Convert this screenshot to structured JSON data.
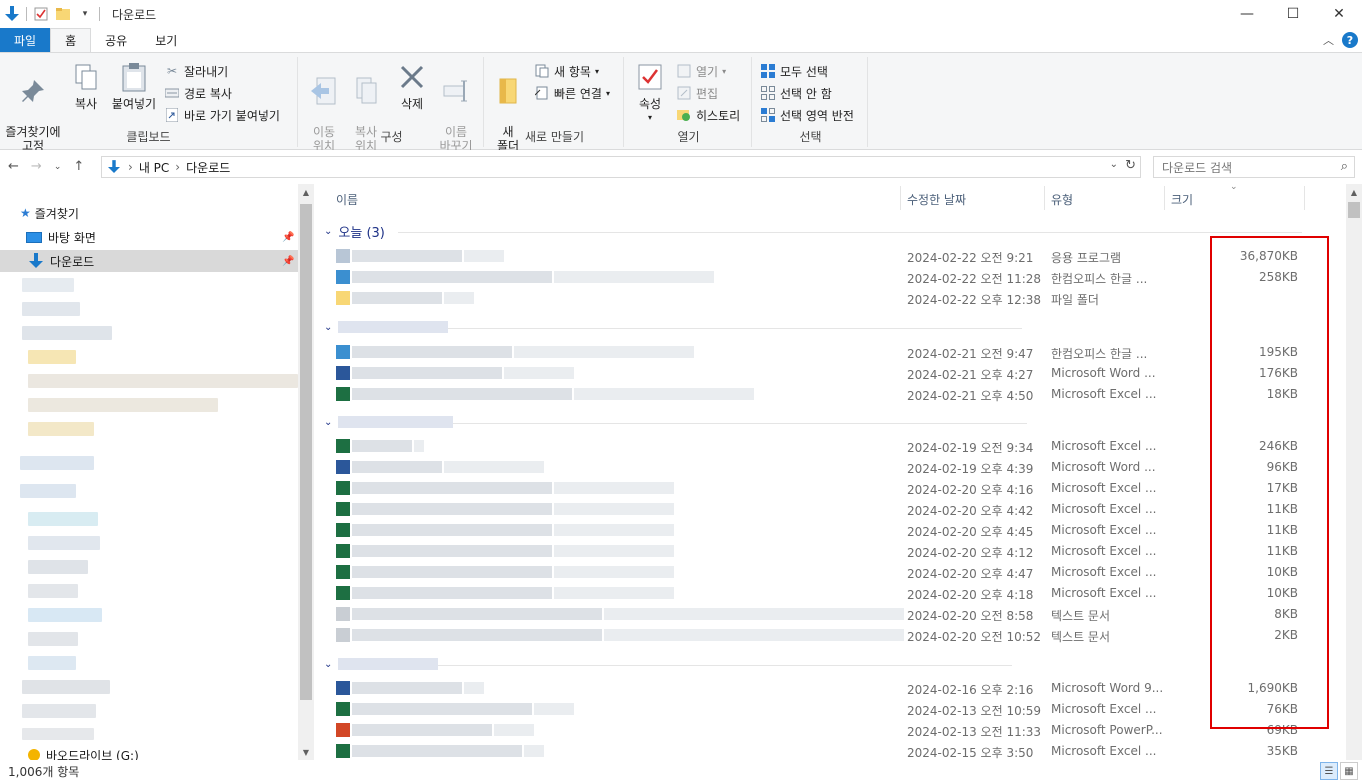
{
  "window": {
    "title": "다운로드",
    "controls": [
      "minimize",
      "maximize",
      "close"
    ]
  },
  "ribbon_tabs": [
    {
      "label": "파일"
    },
    {
      "label": "홈"
    },
    {
      "label": "공유"
    },
    {
      "label": "보기"
    }
  ],
  "ribbon": {
    "clipboard": {
      "pin": "즐겨찾기에\n고정",
      "copy": "복사",
      "paste": "붙여넣기",
      "cut": "잘라내기",
      "copy_path": "경로 복사",
      "paste_shortcut": "바로 가기 붙여넣기",
      "label": "클립보드"
    },
    "organize": {
      "move_to": "이동\n위치",
      "copy_to": "복사\n위치",
      "delete": "삭제",
      "rename": "이름\n바꾸기",
      "label": "구성"
    },
    "new": {
      "new_folder": "새\n폴더",
      "new_item": "새 항목",
      "easy_access": "빠른 연결",
      "label": "새로 만들기"
    },
    "open": {
      "properties": "속성",
      "open": "열기",
      "edit": "편집",
      "history": "히스토리",
      "label": "열기"
    },
    "select": {
      "select_all": "모두 선택",
      "select_none": "선택 안 함",
      "invert": "선택 영역 반전",
      "label": "선택"
    }
  },
  "address": {
    "crumbs": [
      "내 PC",
      "다운로드"
    ],
    "search_placeholder": "다운로드 검색"
  },
  "nav": {
    "quick_access": "즐겨찾기",
    "desktop": "바탕 화면",
    "downloads": "다운로드",
    "bottom_item": "바오드라이브 (G:)"
  },
  "columns": {
    "name": "이름",
    "modified": "수정한 날짜",
    "type": "유형",
    "size": "크기"
  },
  "groups": [
    {
      "label": "오늘 (3)",
      "files": [
        {
          "date": "2024-02-22 오전 9:21",
          "type": "응용 프로그램",
          "size": "36,870KB",
          "icon": "app"
        },
        {
          "date": "2024-02-22 오전 11:28",
          "type": "한컴오피스 한글 ...",
          "size": "258KB",
          "icon": "hwp"
        },
        {
          "date": "2024-02-22 오후 12:38",
          "type": "파일 폴더",
          "size": "",
          "icon": "folder"
        }
      ]
    },
    {
      "label": "",
      "files": [
        {
          "date": "2024-02-21 오전 9:47",
          "type": "한컴오피스 한글 ...",
          "size": "195KB",
          "icon": "hwp"
        },
        {
          "date": "2024-02-21 오후 4:27",
          "type": "Microsoft Word ...",
          "size": "176KB",
          "icon": "word"
        },
        {
          "date": "2024-02-21 오후 4:50",
          "type": "Microsoft Excel ...",
          "size": "18KB",
          "icon": "excel"
        }
      ]
    },
    {
      "label": "",
      "files": [
        {
          "date": "2024-02-19 오전 9:34",
          "type": "Microsoft Excel ...",
          "size": "246KB",
          "icon": "excel"
        },
        {
          "date": "2024-02-19 오후 4:39",
          "type": "Microsoft Word ...",
          "size": "96KB",
          "icon": "word"
        },
        {
          "date": "2024-02-20 오후 4:16",
          "type": "Microsoft Excel ...",
          "size": "17KB",
          "icon": "excel"
        },
        {
          "date": "2024-02-20 오후 4:42",
          "type": "Microsoft Excel ...",
          "size": "11KB",
          "icon": "excel"
        },
        {
          "date": "2024-02-20 오후 4:45",
          "type": "Microsoft Excel ...",
          "size": "11KB",
          "icon": "excel"
        },
        {
          "date": "2024-02-20 오후 4:12",
          "type": "Microsoft Excel ...",
          "size": "11KB",
          "icon": "excel"
        },
        {
          "date": "2024-02-20 오후 4:47",
          "type": "Microsoft Excel ...",
          "size": "10KB",
          "icon": "excel"
        },
        {
          "date": "2024-02-20 오후 4:18",
          "type": "Microsoft Excel ...",
          "size": "10KB",
          "icon": "excel"
        },
        {
          "date": "2024-02-20 오전 8:58",
          "type": "텍스트 문서",
          "size": "8KB",
          "icon": "txt"
        },
        {
          "date": "2024-02-20 오전 10:52",
          "type": "텍스트 문서",
          "size": "2KB",
          "icon": "txt"
        }
      ]
    },
    {
      "label": "",
      "files": [
        {
          "date": "2024-02-16 오후 2:16",
          "type": "Microsoft Word 9...",
          "size": "1,690KB",
          "icon": "word"
        },
        {
          "date": "2024-02-13 오전 10:59",
          "type": "Microsoft Excel ...",
          "size": "76KB",
          "icon": "excel"
        },
        {
          "date": "2024-02-13 오전 11:33",
          "type": "Microsoft PowerP...",
          "size": "69KB",
          "icon": "ppt"
        },
        {
          "date": "2024-02-15 오후 3:50",
          "type": "Microsoft Excel ...",
          "size": "35KB",
          "icon": "excel"
        }
      ]
    }
  ],
  "status": {
    "item_count": "1,006개 항목"
  },
  "colors": {
    "accent": "#1979ca",
    "highlight": "#e00000",
    "excel": "#1d6f42",
    "word": "#2b579a",
    "ppt": "#d24726",
    "hwp": "#3b8fd0"
  }
}
